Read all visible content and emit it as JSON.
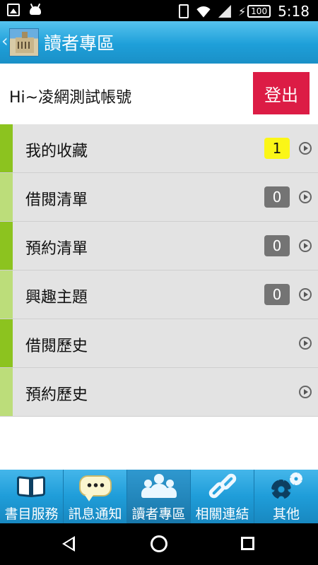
{
  "status_bar": {
    "time": "5:18",
    "battery": "100"
  },
  "header": {
    "title": "讀者專區"
  },
  "user": {
    "greeting": "Hi~凌網測試帳號",
    "logout_label": "登出"
  },
  "menu": [
    {
      "label": "我的收藏",
      "badge": "1",
      "badge_style": "yellow",
      "accent": "#8cc31f"
    },
    {
      "label": "借閱清單",
      "badge": "0",
      "badge_style": "gray",
      "accent": "#bcdd7a"
    },
    {
      "label": "預約清單",
      "badge": "0",
      "badge_style": "gray",
      "accent": "#8cc31f"
    },
    {
      "label": "興趣主題",
      "badge": "0",
      "badge_style": "gray",
      "accent": "#bcdd7a"
    },
    {
      "label": "借閱歷史",
      "badge": null,
      "accent": "#8cc31f"
    },
    {
      "label": "預約歷史",
      "badge": null,
      "accent": "#bcdd7a"
    }
  ],
  "bottom_nav": [
    {
      "label": "書目服務",
      "icon": "book-icon"
    },
    {
      "label": "訊息通知",
      "icon": "chat-icon"
    },
    {
      "label": "讀者專區",
      "icon": "people-icon",
      "active": true
    },
    {
      "label": "相關連結",
      "icon": "link-icon"
    },
    {
      "label": "其他",
      "icon": "gear-icon"
    }
  ],
  "colors": {
    "header_blue": "#1e9fd9",
    "logout_red": "#dc1c45",
    "accent_green": "#8cc31f",
    "accent_light_green": "#bcdd7a",
    "badge_yellow": "#fbf617",
    "badge_gray": "#747474"
  }
}
